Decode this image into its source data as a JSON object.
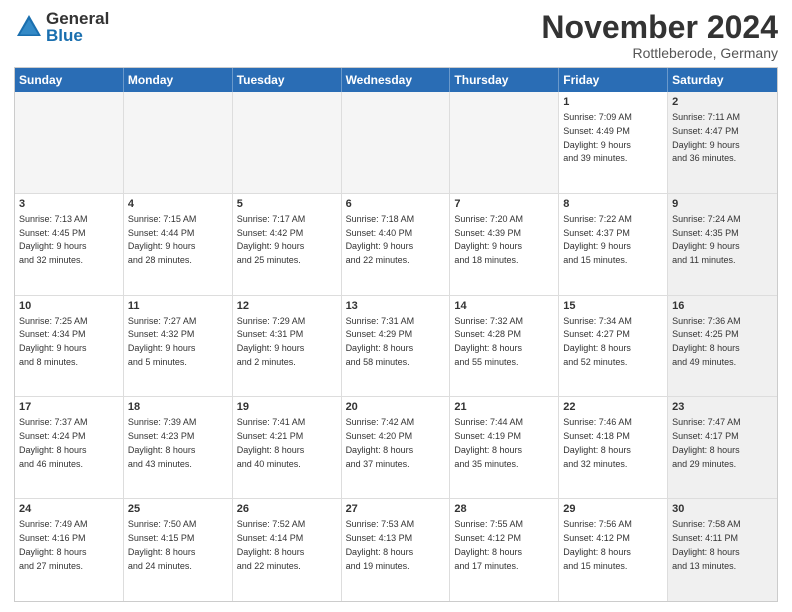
{
  "logo": {
    "general": "General",
    "blue": "Blue"
  },
  "title": "November 2024",
  "location": "Rottleberode, Germany",
  "header": {
    "days": [
      "Sunday",
      "Monday",
      "Tuesday",
      "Wednesday",
      "Thursday",
      "Friday",
      "Saturday"
    ]
  },
  "weeks": [
    [
      {
        "day": "",
        "info": "",
        "empty": true
      },
      {
        "day": "",
        "info": "",
        "empty": true
      },
      {
        "day": "",
        "info": "",
        "empty": true
      },
      {
        "day": "",
        "info": "",
        "empty": true
      },
      {
        "day": "",
        "info": "",
        "empty": true
      },
      {
        "day": "1",
        "info": "Sunrise: 7:09 AM\nSunset: 4:49 PM\nDaylight: 9 hours\nand 39 minutes.",
        "empty": false,
        "shaded": false
      },
      {
        "day": "2",
        "info": "Sunrise: 7:11 AM\nSunset: 4:47 PM\nDaylight: 9 hours\nand 36 minutes.",
        "empty": false,
        "shaded": true
      }
    ],
    [
      {
        "day": "3",
        "info": "Sunrise: 7:13 AM\nSunset: 4:45 PM\nDaylight: 9 hours\nand 32 minutes.",
        "empty": false,
        "shaded": false
      },
      {
        "day": "4",
        "info": "Sunrise: 7:15 AM\nSunset: 4:44 PM\nDaylight: 9 hours\nand 28 minutes.",
        "empty": false,
        "shaded": false
      },
      {
        "day": "5",
        "info": "Sunrise: 7:17 AM\nSunset: 4:42 PM\nDaylight: 9 hours\nand 25 minutes.",
        "empty": false,
        "shaded": false
      },
      {
        "day": "6",
        "info": "Sunrise: 7:18 AM\nSunset: 4:40 PM\nDaylight: 9 hours\nand 22 minutes.",
        "empty": false,
        "shaded": false
      },
      {
        "day": "7",
        "info": "Sunrise: 7:20 AM\nSunset: 4:39 PM\nDaylight: 9 hours\nand 18 minutes.",
        "empty": false,
        "shaded": false
      },
      {
        "day": "8",
        "info": "Sunrise: 7:22 AM\nSunset: 4:37 PM\nDaylight: 9 hours\nand 15 minutes.",
        "empty": false,
        "shaded": false
      },
      {
        "day": "9",
        "info": "Sunrise: 7:24 AM\nSunset: 4:35 PM\nDaylight: 9 hours\nand 11 minutes.",
        "empty": false,
        "shaded": true
      }
    ],
    [
      {
        "day": "10",
        "info": "Sunrise: 7:25 AM\nSunset: 4:34 PM\nDaylight: 9 hours\nand 8 minutes.",
        "empty": false,
        "shaded": false
      },
      {
        "day": "11",
        "info": "Sunrise: 7:27 AM\nSunset: 4:32 PM\nDaylight: 9 hours\nand 5 minutes.",
        "empty": false,
        "shaded": false
      },
      {
        "day": "12",
        "info": "Sunrise: 7:29 AM\nSunset: 4:31 PM\nDaylight: 9 hours\nand 2 minutes.",
        "empty": false,
        "shaded": false
      },
      {
        "day": "13",
        "info": "Sunrise: 7:31 AM\nSunset: 4:29 PM\nDaylight: 8 hours\nand 58 minutes.",
        "empty": false,
        "shaded": false
      },
      {
        "day": "14",
        "info": "Sunrise: 7:32 AM\nSunset: 4:28 PM\nDaylight: 8 hours\nand 55 minutes.",
        "empty": false,
        "shaded": false
      },
      {
        "day": "15",
        "info": "Sunrise: 7:34 AM\nSunset: 4:27 PM\nDaylight: 8 hours\nand 52 minutes.",
        "empty": false,
        "shaded": false
      },
      {
        "day": "16",
        "info": "Sunrise: 7:36 AM\nSunset: 4:25 PM\nDaylight: 8 hours\nand 49 minutes.",
        "empty": false,
        "shaded": true
      }
    ],
    [
      {
        "day": "17",
        "info": "Sunrise: 7:37 AM\nSunset: 4:24 PM\nDaylight: 8 hours\nand 46 minutes.",
        "empty": false,
        "shaded": false
      },
      {
        "day": "18",
        "info": "Sunrise: 7:39 AM\nSunset: 4:23 PM\nDaylight: 8 hours\nand 43 minutes.",
        "empty": false,
        "shaded": false
      },
      {
        "day": "19",
        "info": "Sunrise: 7:41 AM\nSunset: 4:21 PM\nDaylight: 8 hours\nand 40 minutes.",
        "empty": false,
        "shaded": false
      },
      {
        "day": "20",
        "info": "Sunrise: 7:42 AM\nSunset: 4:20 PM\nDaylight: 8 hours\nand 37 minutes.",
        "empty": false,
        "shaded": false
      },
      {
        "day": "21",
        "info": "Sunrise: 7:44 AM\nSunset: 4:19 PM\nDaylight: 8 hours\nand 35 minutes.",
        "empty": false,
        "shaded": false
      },
      {
        "day": "22",
        "info": "Sunrise: 7:46 AM\nSunset: 4:18 PM\nDaylight: 8 hours\nand 32 minutes.",
        "empty": false,
        "shaded": false
      },
      {
        "day": "23",
        "info": "Sunrise: 7:47 AM\nSunset: 4:17 PM\nDaylight: 8 hours\nand 29 minutes.",
        "empty": false,
        "shaded": true
      }
    ],
    [
      {
        "day": "24",
        "info": "Sunrise: 7:49 AM\nSunset: 4:16 PM\nDaylight: 8 hours\nand 27 minutes.",
        "empty": false,
        "shaded": false
      },
      {
        "day": "25",
        "info": "Sunrise: 7:50 AM\nSunset: 4:15 PM\nDaylight: 8 hours\nand 24 minutes.",
        "empty": false,
        "shaded": false
      },
      {
        "day": "26",
        "info": "Sunrise: 7:52 AM\nSunset: 4:14 PM\nDaylight: 8 hours\nand 22 minutes.",
        "empty": false,
        "shaded": false
      },
      {
        "day": "27",
        "info": "Sunrise: 7:53 AM\nSunset: 4:13 PM\nDaylight: 8 hours\nand 19 minutes.",
        "empty": false,
        "shaded": false
      },
      {
        "day": "28",
        "info": "Sunrise: 7:55 AM\nSunset: 4:12 PM\nDaylight: 8 hours\nand 17 minutes.",
        "empty": false,
        "shaded": false
      },
      {
        "day": "29",
        "info": "Sunrise: 7:56 AM\nSunset: 4:12 PM\nDaylight: 8 hours\nand 15 minutes.",
        "empty": false,
        "shaded": false
      },
      {
        "day": "30",
        "info": "Sunrise: 7:58 AM\nSunset: 4:11 PM\nDaylight: 8 hours\nand 13 minutes.",
        "empty": false,
        "shaded": true
      }
    ]
  ]
}
